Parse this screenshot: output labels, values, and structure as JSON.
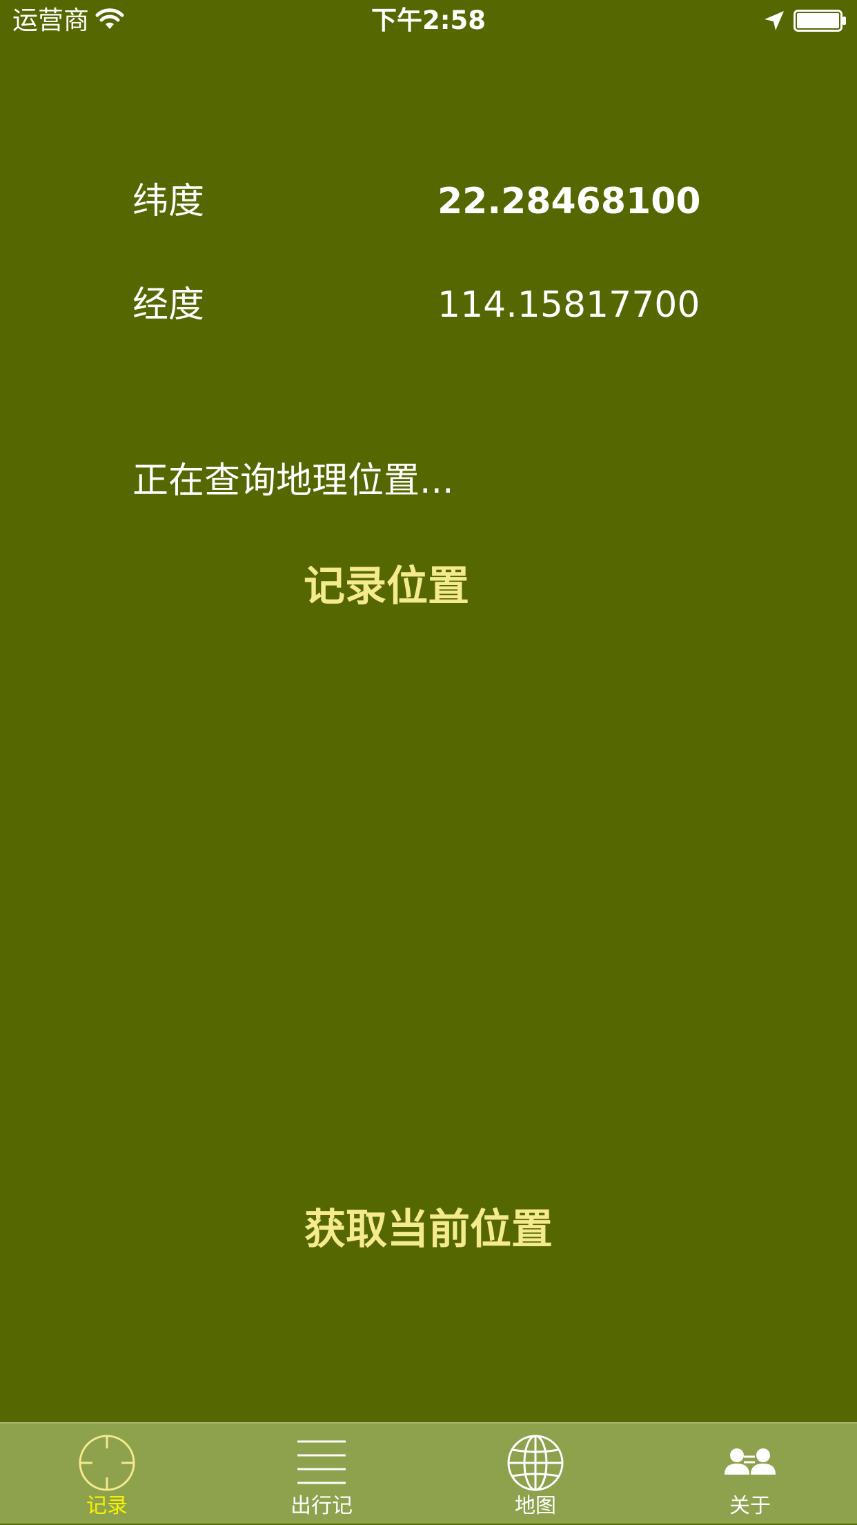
{
  "status_bar": {
    "carrier": "运营商",
    "time": "下午2:58"
  },
  "location": {
    "latitude_label": "纬度",
    "latitude_value": "22.28468100",
    "longitude_label": "经度",
    "longitude_value": "114.15817700",
    "address_status": "正在查询地理位置..."
  },
  "actions": {
    "record_label": "记录位置",
    "get_location_label": "获取当前位置"
  },
  "tab_bar": {
    "tabs": [
      {
        "label": "记录",
        "icon": "crosshair-icon",
        "active": true
      },
      {
        "label": "出行记",
        "icon": "list-icon",
        "active": false
      },
      {
        "label": "地图",
        "icon": "globe-icon",
        "active": false
      },
      {
        "label": "关于",
        "icon": "people-icon",
        "active": false
      }
    ]
  },
  "colors": {
    "background": "#556700",
    "tab_bar": "#8ea24e",
    "accent_button_text": "#f5ea8e",
    "active_tab": "#f8f200"
  }
}
